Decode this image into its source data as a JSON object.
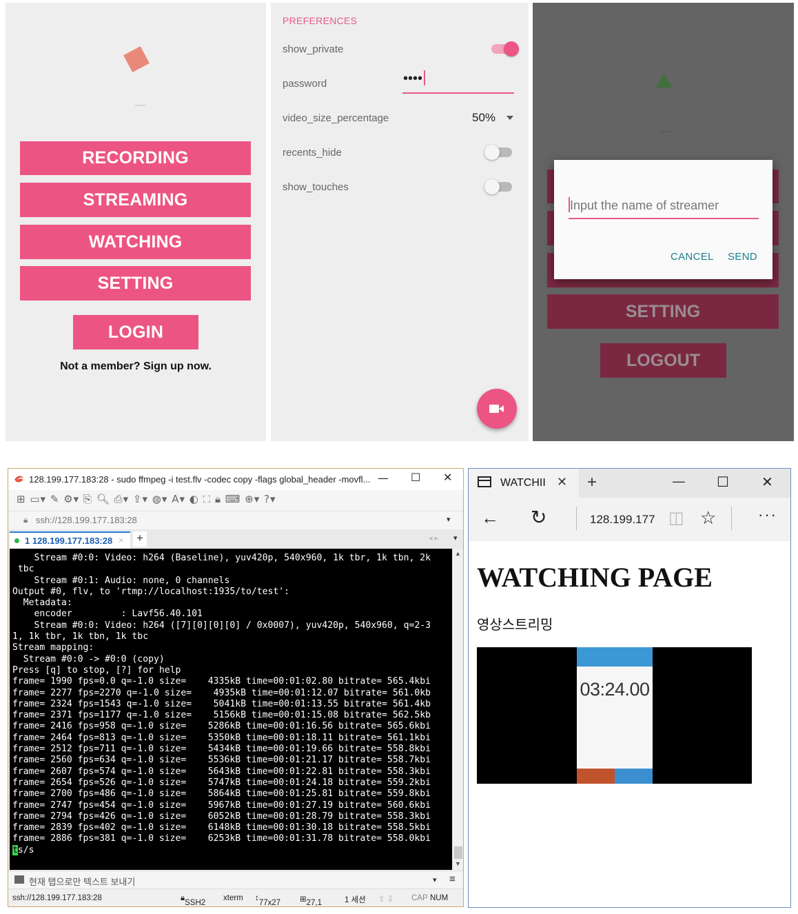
{
  "phone_home": {
    "buttons": [
      "RECORDING",
      "STREAMING",
      "WATCHING",
      "SETTING"
    ],
    "login_label": "LOGIN",
    "signup_text": "Not a member? Sign up now."
  },
  "phone_prefs": {
    "header": "PREFERENCES",
    "show_private": {
      "label": "show_private",
      "value": true
    },
    "password": {
      "label": "password",
      "value": "••••"
    },
    "video_size": {
      "label": "video_size_percentage",
      "value": "50%"
    },
    "recents_hide": {
      "label": "recents_hide",
      "value": false
    },
    "show_touches": {
      "label": "show_touches",
      "value": false
    },
    "fab_icon": "videocam-icon",
    "accent_color": "#ec5583"
  },
  "phone_dialog": {
    "input_placeholder": "Input the name of streamer",
    "cancel_label": "CANCEL",
    "send_label": "SEND",
    "setting_label": "SETTING",
    "logout_label": "LOGOUT"
  },
  "terminal": {
    "title": "128.199.177.183:28 - sudo ffmpeg -i test.flv -codec copy -flags global_header -movfl...",
    "address": "ssh://128.199.177.183:28",
    "tab_label": "1 128.199.177.183:28",
    "output": "    Stream #0:0: Video: h264 (Baseline), yuv420p, 540x960, 1k tbr, 1k tbn, 2k\n tbc\n    Stream #0:1: Audio: none, 0 channels\nOutput #0, flv, to 'rtmp://localhost:1935/to/test':\n  Metadata:\n    encoder         : Lavf56.40.101\n    Stream #0:0: Video: h264 ([7][0][0][0] / 0x0007), yuv420p, 540x960, q=2-3\n1, 1k tbr, 1k tbn, 1k tbc\nStream mapping:\n  Stream #0:0 -> #0:0 (copy)\nPress [q] to stop, [?] for help\nframe= 1990 fps=0.0 q=-1.0 size=    4335kB time=00:01:02.80 bitrate= 565.4kbi\nframe= 2277 fps=2270 q=-1.0 size=    4935kB time=00:01:12.07 bitrate= 561.0kb\nframe= 2324 fps=1543 q=-1.0 size=    5041kB time=00:01:13.55 bitrate= 561.4kb\nframe= 2371 fps=1177 q=-1.0 size=    5156kB time=00:01:15.08 bitrate= 562.5kb\nframe= 2416 fps=958 q=-1.0 size=    5286kB time=00:01:16.56 bitrate= 565.6kbi\nframe= 2464 fps=813 q=-1.0 size=    5350kB time=00:01:18.11 bitrate= 561.1kbi\nframe= 2512 fps=711 q=-1.0 size=    5434kB time=00:01:19.66 bitrate= 558.8kbi\nframe= 2560 fps=634 q=-1.0 size=    5536kB time=00:01:21.17 bitrate= 558.7kbi\nframe= 2607 fps=574 q=-1.0 size=    5643kB time=00:01:22.81 bitrate= 558.3kbi\nframe= 2654 fps=526 q=-1.0 size=    5747kB time=00:01:24.18 bitrate= 559.2kbi\nframe= 2700 fps=486 q=-1.0 size=    5864kB time=00:01:25.81 bitrate= 559.8kbi\nframe= 2747 fps=454 q=-1.0 size=    5967kB time=00:01:27.19 bitrate= 560.6kbi\nframe= 2794 fps=426 q=-1.0 size=    6052kB time=00:01:28.79 bitrate= 558.3kbi\nframe= 2839 fps=402 q=-1.0 size=    6148kB time=00:01:30.18 bitrate= 558.5kbi\nframe= 2886 fps=381 q=-1.0 size=    6253kB time=00:01:31.78 bitrate= 558.0kbi",
    "cursor_char": "t",
    "last_line_rest": "s/s",
    "send_bar_text": "현재 탭으로만 텍스트 보내기",
    "status": {
      "address": "ssh://128.199.177.183:28",
      "protocol": "SSH2",
      "term": "xterm",
      "size": "77x27",
      "cursor": "27,1",
      "sessions": "1 세션",
      "cap": "CAP",
      "num": "NUM"
    }
  },
  "browser": {
    "tab_title": "WATCHII",
    "address": "128.199.177",
    "heading": "WATCHING PAGE",
    "subtitle": "영상스트리밍",
    "video_time": "03:24.00"
  }
}
